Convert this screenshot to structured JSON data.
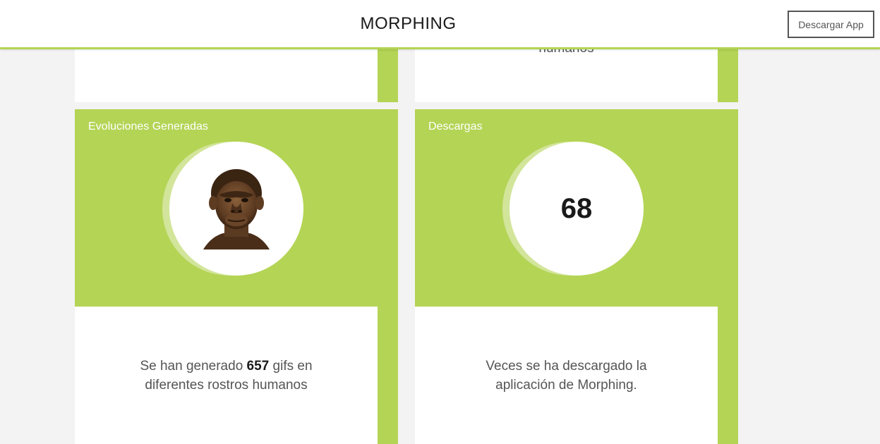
{
  "header": {
    "brand": "MORPHING",
    "download_button": "Descargar App"
  },
  "previous_row": {
    "right_card_text_fragment": "humanos"
  },
  "cards": [
    {
      "title": "Evoluciones Generadas",
      "image": "hominid-face-icon",
      "text_before": "Se han generado ",
      "count": "657",
      "text_after": " gifs en diferentes rostros humanos"
    },
    {
      "title": "Descargas",
      "counter": "68",
      "text": "Veces se ha descargado la aplicación de Morphing."
    }
  ],
  "colors": {
    "accent_green": "#b4d455",
    "light_green": "#d2e59a",
    "page_background": "#f3f3f3"
  }
}
